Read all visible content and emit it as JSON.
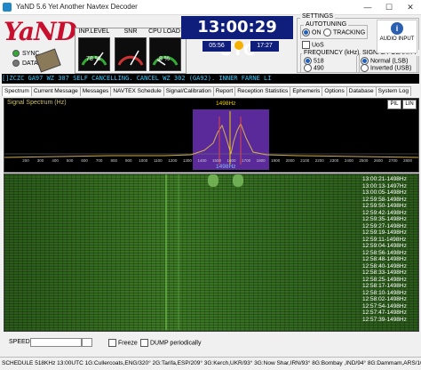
{
  "window": {
    "title": "YaND 5.6 Yet Another Navtex Decoder",
    "min": "—",
    "max": "☐",
    "close": "✕"
  },
  "logo": "YaND",
  "indicators": {
    "sync": "SYNC",
    "data": "DATA"
  },
  "gauges": [
    {
      "label": "INP.LEVEL",
      "value": "78 %"
    },
    {
      "label": "SNR",
      "value": ""
    },
    {
      "label": "CPU LOAD",
      "value": "8 %"
    }
  ],
  "clock": {
    "utc": "13:00:29 UTC",
    "sunrise": "05:56",
    "sunset": "17:27"
  },
  "settings": {
    "title": "SETTINGS",
    "autotuning": {
      "label": "AUTOTUNING",
      "on": "ON",
      "tracking": "TRACKING"
    },
    "uos": "UoS",
    "frequency": {
      "label": "FREQUENCY (kHz)",
      "opt1": "518",
      "opt2": "490"
    },
    "polarity": {
      "label": "SIGNAL POLARITY",
      "opt1": "Normal (LSB)",
      "opt2": "Inverted (USB)"
    },
    "audio_input": "AUDIO INPUT"
  },
  "message_line": "[]ZCZC GA97   WZ 307  SELF CANCELLING.  CANCEL WZ 302 (GA92).  INNER FARNE LI",
  "tabs": [
    "Spectrum",
    "Current Message",
    "Messages",
    "NAVTEX Schedule",
    "Signal/Calibration",
    "Report",
    "Reception Statistics",
    "Ephemeris",
    "Options",
    "Database",
    "System Log"
  ],
  "spectrum": {
    "title": "Signal Spectrum (Hz)",
    "pil": "PIL",
    "lin": "LIN",
    "marker_top": "1498Hz",
    "marker_bottom": "1498Hz",
    "ticks": [
      "200",
      "300",
      "400",
      "500",
      "600",
      "700",
      "800",
      "900",
      "1000",
      "1100",
      "1200",
      "1300",
      "1400",
      "1500",
      "1600",
      "1700",
      "1800",
      "1900",
      "2000",
      "2100",
      "2200",
      "2300",
      "2400",
      "2500",
      "2600",
      "2700",
      "2800"
    ]
  },
  "waterfall_times": [
    "13:00:21-1498Hz",
    "13:00:13-1497Hz",
    "13:00:05-1498Hz",
    "12:59:58-1498Hz",
    "12:59:50-1498Hz",
    "12:59:42-1498Hz",
    "12:59:35-1498Hz",
    "12:59:27-1498Hz",
    "12:59:19-1498Hz",
    "12:59:11-1498Hz",
    "12:59:04-1498Hz",
    "12:58:56-1498Hz",
    "12:58:48-1498Hz",
    "12:58:40-1498Hz",
    "12:58:33-1498Hz",
    "12:58:25-1498Hz",
    "12:58:17-1498Hz",
    "12:58:10-1498Hz",
    "12:58:02-1498Hz",
    "12:57:54-1498Hz",
    "12:57:47-1498Hz",
    "12:57:39-1498Hz"
  ],
  "bottom": {
    "speed": "SPEED",
    "freeze": "Freeze",
    "dump": "DUMP periodically"
  },
  "status": "SCHEDULE 518KHz 13:00UTC 1G:Cullercoats,ENG/320° 2G:Tarifa,ESP/209° 3G:Kerch,UKR/93° 3G:Now Shar,IRN/93° 8G:Bombay ,IND/94° 8G:Dammam,ARS/108° 11G:Naha ,J"
}
